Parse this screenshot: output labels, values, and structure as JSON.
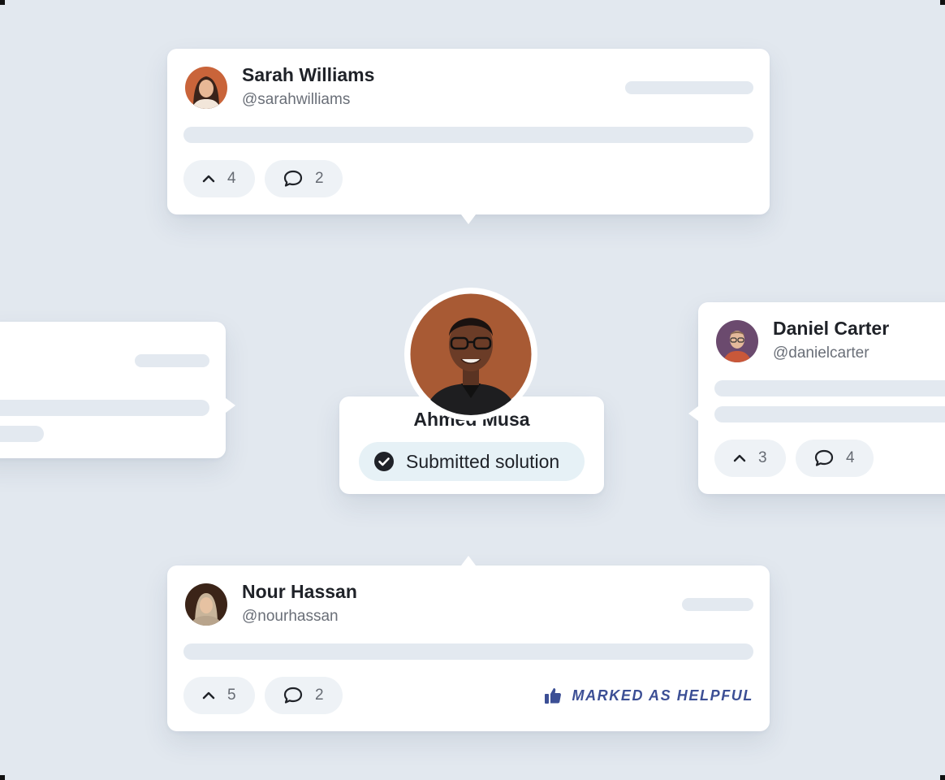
{
  "posts": [
    {
      "id": "sarah",
      "name": "Sarah Williams",
      "handle": "@sarahwilliams",
      "upvotes": "4",
      "comments": "2"
    },
    {
      "id": "daniel",
      "name": "Daniel Carter",
      "handle": "@danielcarter",
      "upvotes": "3",
      "comments": "4"
    },
    {
      "id": "nour",
      "name": "Nour Hassan",
      "handle": "@nourhassan",
      "upvotes": "5",
      "comments": "2",
      "badge": "MARKED AS HELPFUL"
    }
  ],
  "center_user": {
    "name": "Ahmed Musa",
    "status": "Submitted solution"
  },
  "icons": {
    "upvote": "chevron-up-icon",
    "comment": "comment-icon",
    "status": "check-circle-icon",
    "helpful": "thumbs-up-icon"
  },
  "colors": {
    "background": "#e2e8ef",
    "card": "#ffffff",
    "skeleton": "#e3e9f0",
    "pill": "#eef2f6",
    "status_pill": "#e6f1f6",
    "helpful": "#3c4f95"
  }
}
